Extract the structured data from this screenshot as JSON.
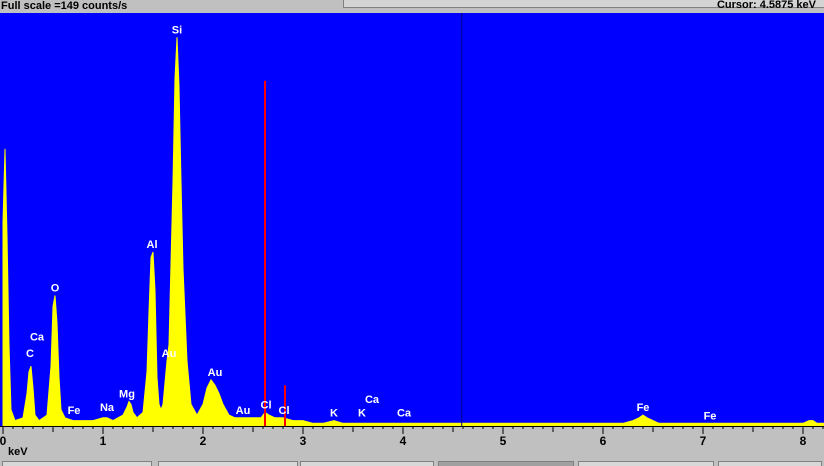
{
  "header": {
    "full_scale_label": "Full scale =149  counts/s",
    "cursor_readout": "Cursor: 4.5875 keV"
  },
  "colors": {
    "background": "#0000ff",
    "spectrum": "#ffff00",
    "marker": "#ff0000",
    "cursor_line": "#000080",
    "peak_label": "#ffffff"
  },
  "chart_data": {
    "type": "area",
    "title": "",
    "xlabel": "keV",
    "ylabel": "",
    "xlim": [
      0,
      8.22
    ],
    "ylim": [
      0,
      149
    ],
    "x_ticks": [
      0,
      1,
      2,
      3,
      4,
      5,
      6,
      7,
      8
    ],
    "grid": false,
    "cursor_kev": 4.5875,
    "series": [
      {
        "x": [
          0.0,
          0.02,
          0.04,
          0.06,
          0.08,
          0.12,
          0.2,
          0.24,
          0.26,
          0.28,
          0.3,
          0.32,
          0.36,
          0.44,
          0.48,
          0.5,
          0.52,
          0.54,
          0.56,
          0.58,
          0.62,
          0.7,
          0.8,
          0.9,
          1.0,
          1.04,
          1.1,
          1.2,
          1.24,
          1.26,
          1.28,
          1.3,
          1.34,
          1.4,
          1.44,
          1.46,
          1.48,
          1.5,
          1.52,
          1.54,
          1.56,
          1.58,
          1.6,
          1.64,
          1.66,
          1.7,
          1.72,
          1.74,
          1.76,
          1.78,
          1.8,
          1.84,
          1.88,
          1.94,
          2.0,
          2.04,
          2.08,
          2.12,
          2.16,
          2.2,
          2.26,
          2.32,
          2.4,
          2.5,
          2.58,
          2.62,
          2.66,
          2.72,
          2.8,
          2.9,
          3.0,
          3.1,
          3.2,
          3.31,
          3.4,
          3.5,
          3.6,
          3.7,
          3.8,
          3.9,
          4.0,
          4.1,
          4.3,
          4.5,
          4.7,
          5.0,
          5.5,
          6.0,
          6.2,
          6.3,
          6.36,
          6.4,
          6.44,
          6.5,
          6.56,
          6.7,
          7.0,
          7.06,
          7.2,
          7.6,
          7.9,
          8.0,
          8.06,
          8.1,
          8.14,
          8.22
        ],
        "y": [
          75,
          102,
          70,
          30,
          6,
          2,
          3,
          12,
          20,
          22,
          14,
          4,
          2,
          4,
          22,
          44,
          48,
          38,
          18,
          6,
          3,
          2,
          2,
          2,
          3,
          3,
          2,
          4,
          7,
          9,
          8,
          5,
          3,
          5,
          20,
          42,
          62,
          64,
          50,
          18,
          8,
          6,
          8,
          24,
          30,
          90,
          128,
          143,
          125,
          90,
          58,
          24,
          8,
          4,
          8,
          14,
          17,
          15,
          12,
          8,
          4,
          3,
          3,
          3,
          3,
          5,
          4,
          3,
          3,
          2,
          2,
          1,
          1,
          2,
          1,
          1,
          1,
          1,
          1,
          1,
          1,
          1,
          1,
          1,
          1,
          1,
          1,
          1,
          1,
          2,
          3,
          4,
          3,
          2,
          1,
          1,
          1,
          1,
          1,
          1,
          1,
          1,
          2,
          2,
          1,
          1
        ]
      }
    ],
    "markers": [
      {
        "x": 2.62,
        "y": 127
      },
      {
        "x": 2.82,
        "y": 15
      }
    ],
    "annotations": [
      {
        "text": "Si",
        "x": 1.74,
        "y": 143
      },
      {
        "text": "Al",
        "x": 1.49,
        "y": 64
      },
      {
        "text": "O",
        "x": 0.52,
        "y": 48
      },
      {
        "text": "Ca",
        "x": 0.34,
        "y": 30
      },
      {
        "text": "C",
        "x": 0.27,
        "y": 24
      },
      {
        "text": "Au",
        "x": 1.66,
        "y": 24
      },
      {
        "text": "Au",
        "x": 2.12,
        "y": 17
      },
      {
        "text": "Mg",
        "x": 1.24,
        "y": 9
      },
      {
        "text": "Na",
        "x": 1.04,
        "y": 4
      },
      {
        "text": "Fe",
        "x": 0.71,
        "y": 3
      },
      {
        "text": "Au",
        "x": 2.4,
        "y": 3
      },
      {
        "text": "Cl",
        "x": 2.63,
        "y": 5
      },
      {
        "text": "Cl",
        "x": 2.81,
        "y": 3
      },
      {
        "text": "K",
        "x": 3.31,
        "y": 2
      },
      {
        "text": "K",
        "x": 3.59,
        "y": 2
      },
      {
        "text": "Ca",
        "x": 3.69,
        "y": 7
      },
      {
        "text": "Ca",
        "x": 4.01,
        "y": 2
      },
      {
        "text": "Fe",
        "x": 6.4,
        "y": 4
      },
      {
        "text": "Fe",
        "x": 7.07,
        "y": 1
      }
    ]
  }
}
